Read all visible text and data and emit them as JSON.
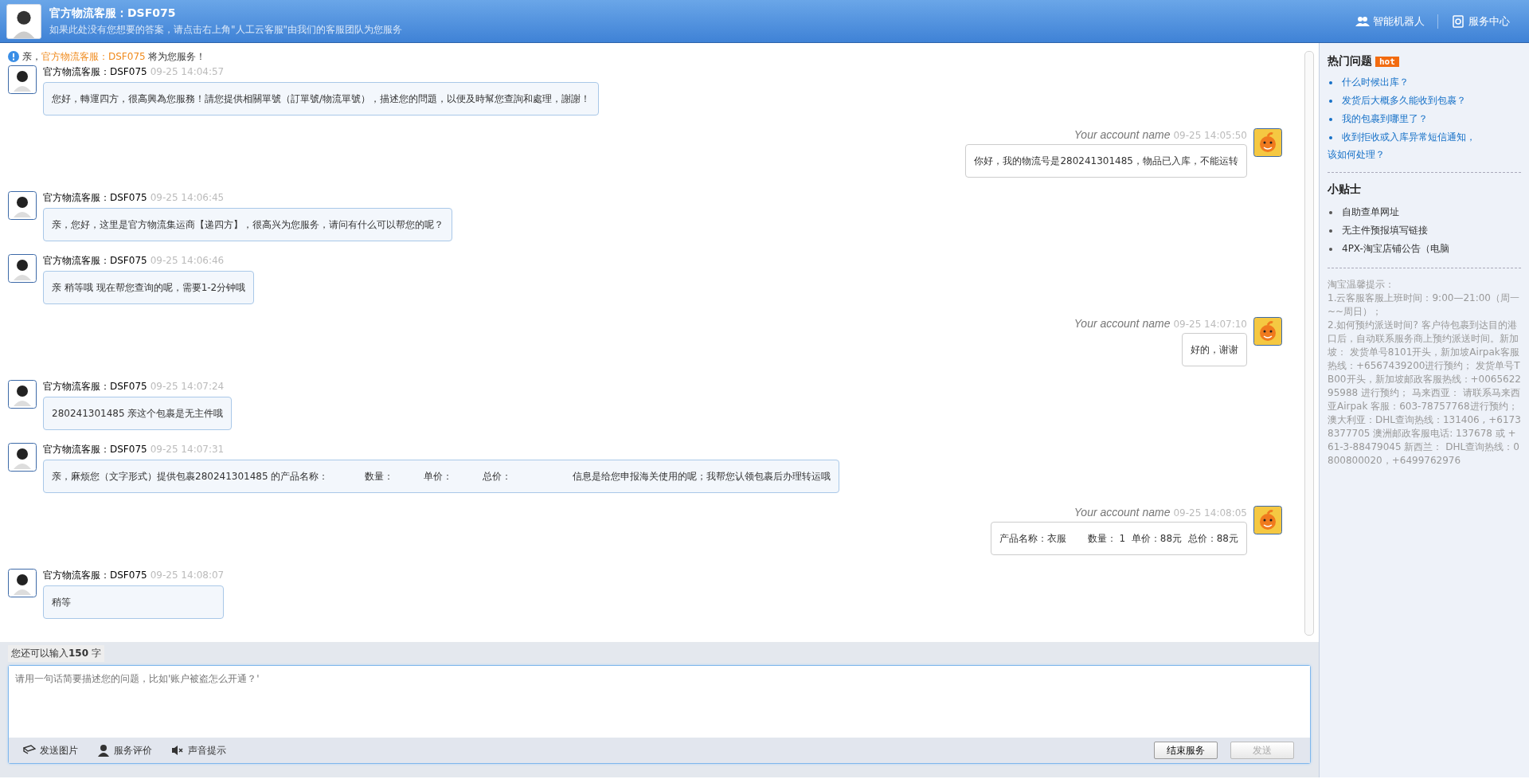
{
  "header": {
    "title": "官方物流客服：DSF075",
    "subtitle": "如果此处没有您想要的答案，请点击右上角\"人工云客服\"由我们的客服团队为您服务",
    "links": [
      {
        "label": "智能机器人",
        "kind": "robot"
      },
      {
        "label": "服务中心",
        "kind": "service"
      }
    ]
  },
  "notice": {
    "prefix": "亲，",
    "agent": "官方物流客服：DSF075",
    "suffix": " 将为您服务！"
  },
  "messages": [
    {
      "kind": "agent",
      "name": "官方物流客服：DSF075",
      "time": "09-25 14:04:57",
      "text": "您好，轉運四方，很高興為您服務！請您提供相關單號（訂單號/物流單號），描述您的問題，以便及時幫您查詢和處理，謝謝！"
    },
    {
      "kind": "user",
      "name": "Your account name",
      "time": "09-25 14:05:50",
      "text": "你好，我的物流号是280241301485，物品已入库，不能运转"
    },
    {
      "kind": "agent",
      "name": "官方物流客服：DSF075",
      "time": "09-25 14:06:45",
      "text": "亲，您好，这里是官方物流集运商【递四方】，很高兴为您服务，请问有什么可以帮您的呢？"
    },
    {
      "kind": "agent",
      "name": "官方物流客服：DSF075",
      "time": "09-25 14:06:46",
      "text": "亲 稍等哦 现在帮您查询的呢，需要1-2分钟哦"
    },
    {
      "kind": "user",
      "name": "Your account name",
      "time": "09-25 14:07:10",
      "text": "好的，谢谢"
    },
    {
      "kind": "agent",
      "name": "官方物流客服：DSF075",
      "time": "09-25 14:07:24",
      "text": "280241301485 亲这个包裹是无主件哦"
    },
    {
      "kind": "agent",
      "name": "官方物流客服：DSF075",
      "time": "09-25 14:07:31",
      "text": "亲，麻烦您（文字形式）提供包裹280241301485 的产品名称：            数量：          单价：          总价：                    信息是给您申报海关使用的呢；我帮您认领包裹后办理转运哦"
    },
    {
      "kind": "user",
      "name": "Your account name",
      "time": "09-25 14:08:05",
      "text": "产品名称：衣服       数量： 1  单价：88元  总价：88元"
    },
    {
      "kind": "agent",
      "name": "官方物流客服：DSF075",
      "time": "09-25 14:08:07",
      "text": "稍等"
    }
  ],
  "input": {
    "counter": "您还可以输入**150** 字",
    "placeholder": "请用一句话简要描述您的问题，比如'账户被盗怎么开通？'"
  },
  "toolbar": [
    {
      "label": "发送图片",
      "kind": "image"
    },
    {
      "label": "服务评价",
      "kind": "rating"
    },
    {
      "label": "声音提示",
      "kind": "mute"
    }
  ],
  "buttons": [
    {
      "label": "结束服务",
      "disabled": false
    },
    {
      "label": "发送",
      "disabled": true
    }
  ],
  "sidebar": {
    "hot_title": "热门问题",
    "hot_badge": "hot",
    "hot_questions": [
      "什么时候出库？",
      "发货后大概多久能收到包裹？",
      "我的包裹到哪里了？",
      "收到拒收或入库异常短信通知，"
    ],
    "hot_continuation": "该如何处理？",
    "tips_title": "小贴士",
    "tips": [
      "自助查单网址",
      "无主件预报填写链接",
      "4PX-淘宝店铺公告（电脑"
    ],
    "notes": [
      "淘宝温馨提示：",
      "1.云客服客服上班时间：9:00—21:00（周一~~周日）；",
      "2.如何预约派送时间? 客户待包裹到达目的港口后，自动联系服务商上预约派送时间。新加坡： 发货单号8101开头，新加坡Airpak客服热线：+6567439200进行预约； 发货单号TB00开头，新加坡邮政客服热线：+006562295988 进行预约； 马来西亚： 请联系马来西亚Airpak 客服：603-78757768进行预约；澳大利亚：DHL查询热线：131406 , +61738377705 澳洲邮政客服电话: 137678 或 +61-3-88479045 新西兰： DHL查询热线：0800800020，+6499762976"
    ]
  }
}
